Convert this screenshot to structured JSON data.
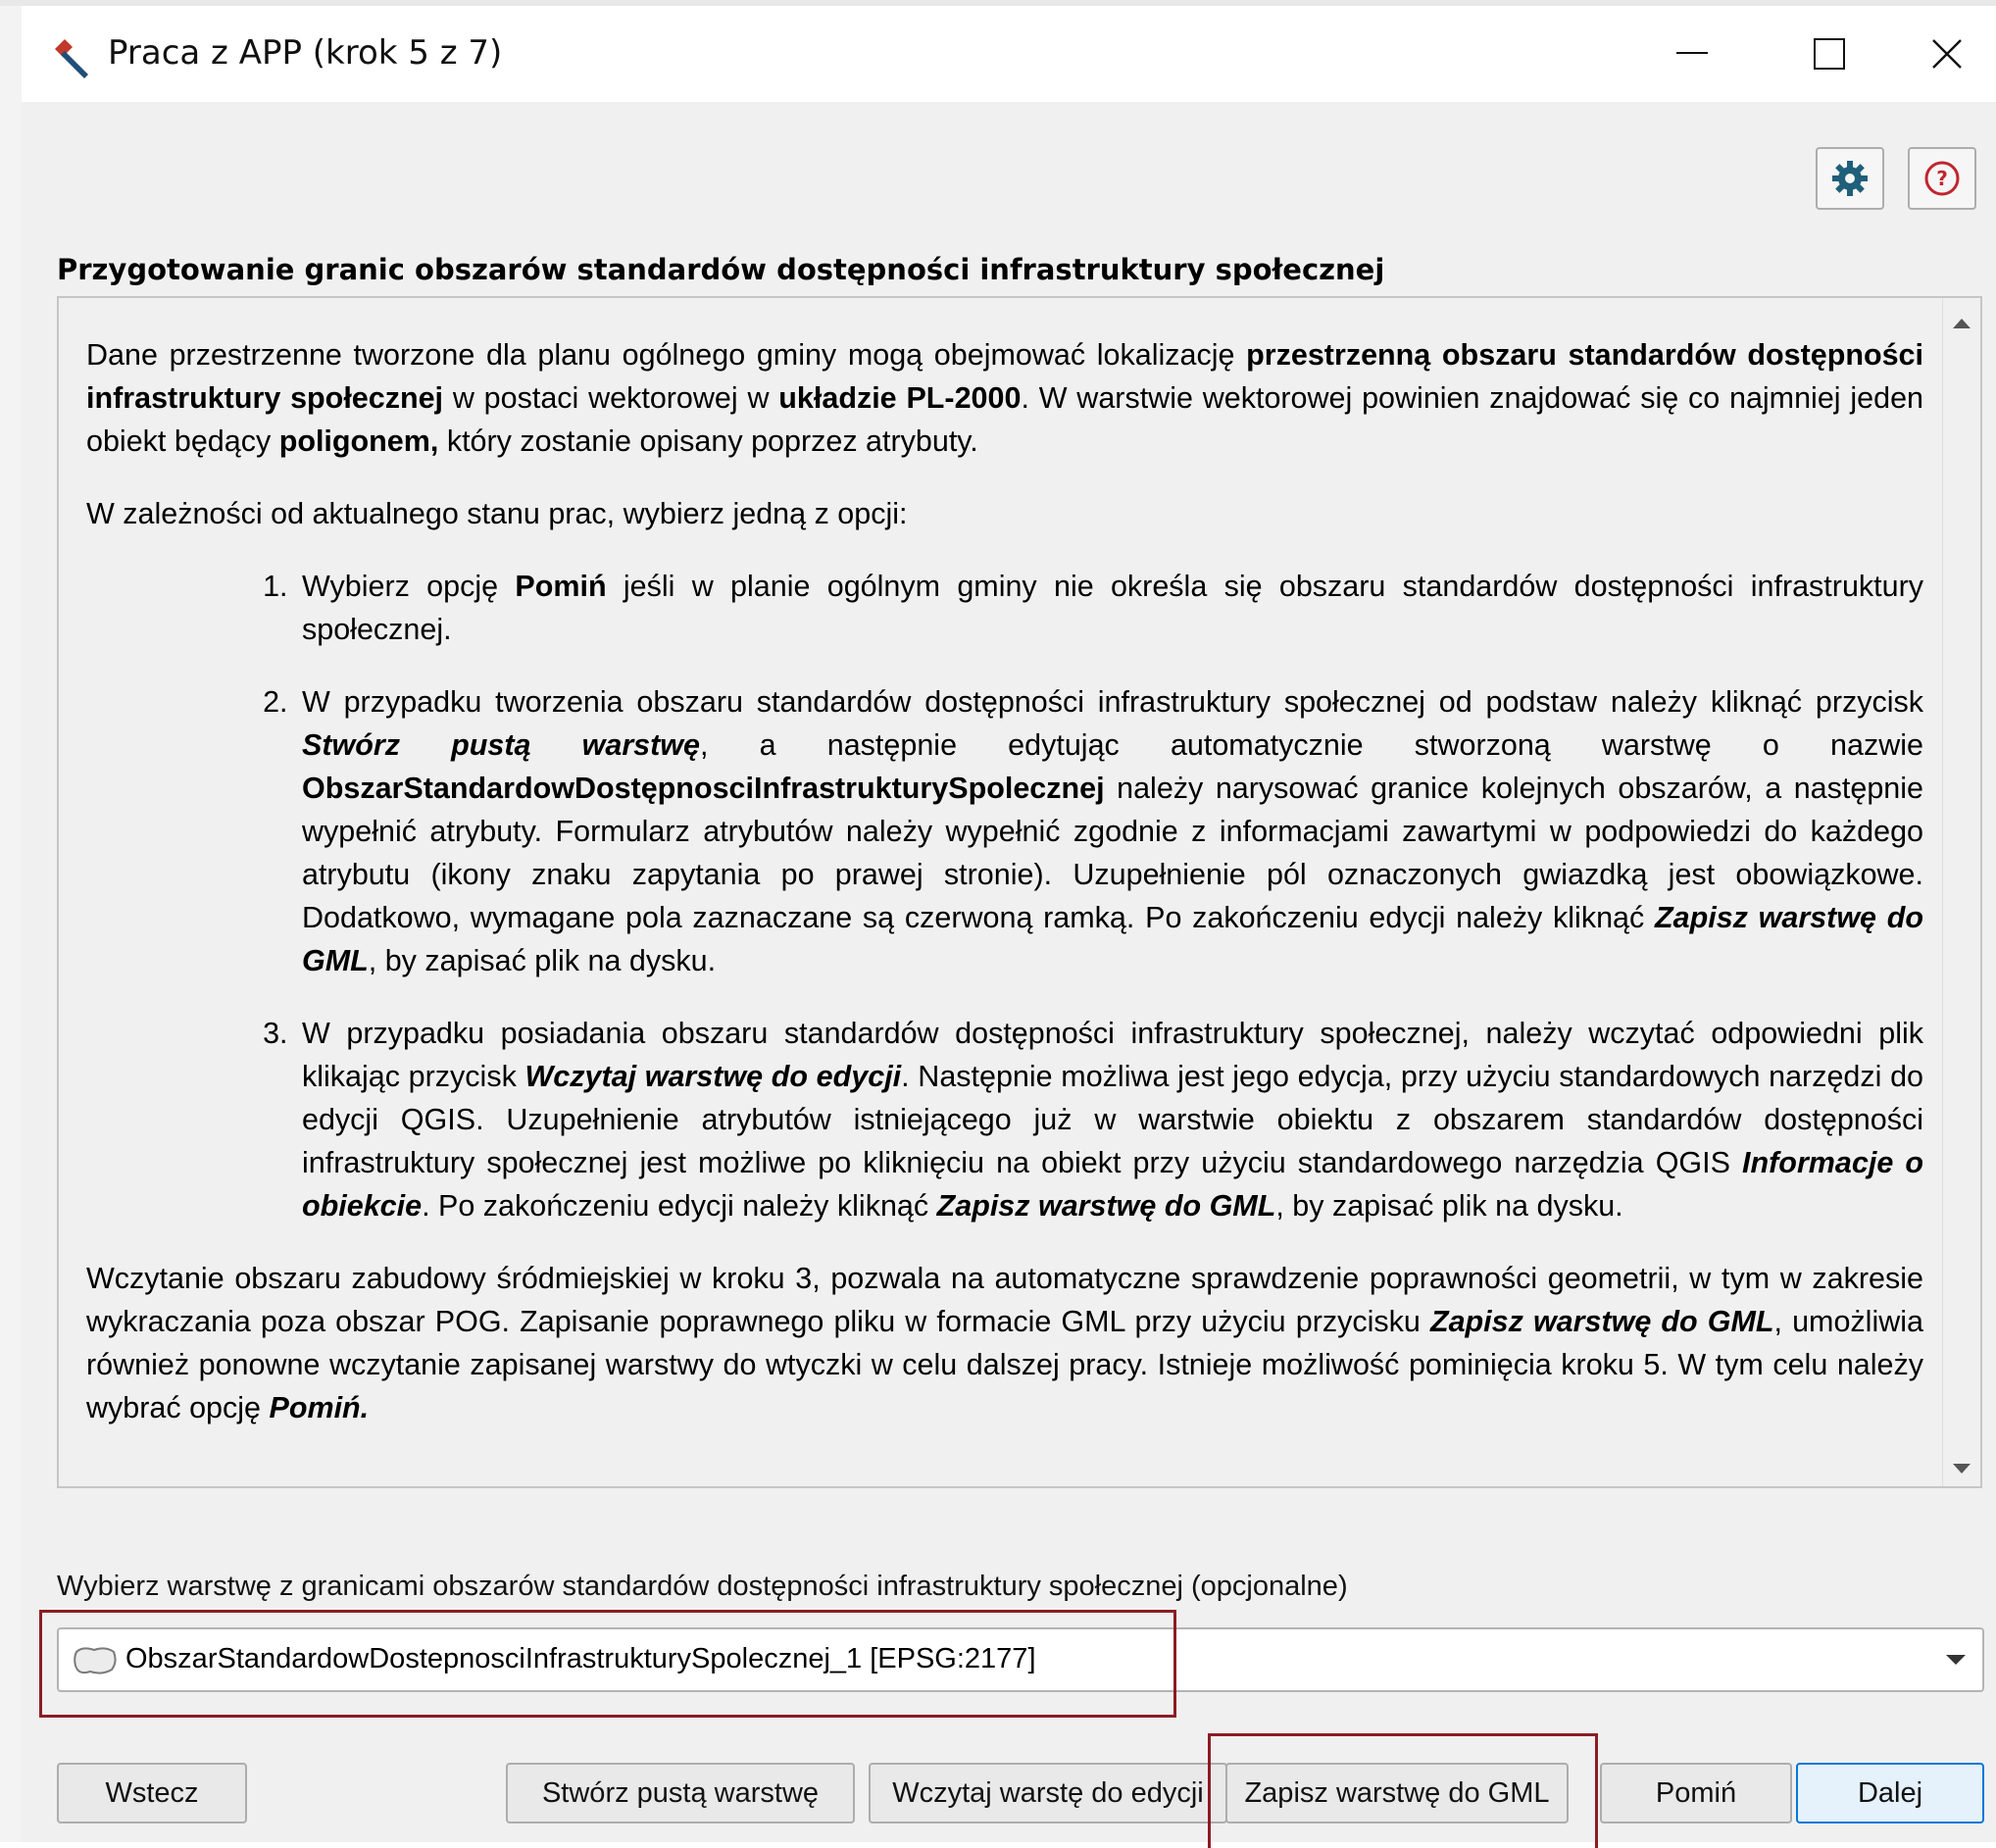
{
  "window": {
    "title": "Praca z APP (krok 5 z 7)"
  },
  "toolbar": {
    "settings_icon": "gear-icon",
    "help_icon": "question-icon"
  },
  "section": {
    "heading": "Przygotowanie granic obszarów standardów dostępności infrastruktury społecznej"
  },
  "description": {
    "p1": {
      "a": "Dane przestrzenne tworzone dla planu ogólnego gminy mogą obejmować lokalizację ",
      "b": "przestrzenną obszaru standardów dostępności infrastruktury społecznej",
      "c": " w postaci wektorowej w ",
      "d": "układzie PL-2000",
      "e": ". W warstwie wektorowej powinien znajdować się co najmniej jeden obiekt będący ",
      "f": "poligonem,",
      "g": " który zostanie opisany poprzez atrybuty."
    },
    "p2": "W zależności od aktualnego stanu prac, wybierz jedną z opcji:",
    "item1": {
      "a": "Wybierz opcję ",
      "b": "Pomiń",
      "c": " jeśli w planie ogólnym gminy nie określa się obszaru standardów dostępności infrastruktury społecznej."
    },
    "item2": {
      "a": "W przypadku tworzenia obszaru standardów dostępności infrastruktury społecznej od podstaw należy kliknąć przycisk  ",
      "b": "Stwórz pustą warstwę",
      "c": ", a następnie edytując automatycznie stworzoną warstwę o nazwie ",
      "d": "ObszarStandardowDostępnosciInfrastrukturySpolecznej",
      "e": " należy narysować granice kolejnych obszarów, a następnie wypełnić atrybuty. Formularz atrybutów należy wypełnić zgodnie z informacjami zawartymi w podpowiedzi do każdego atrybutu (ikony znaku zapytania po prawej stronie).  Uzupełnienie pól oznaczonych gwiazdką jest obowiązkowe. Dodatkowo, wymagane pola zaznaczane są czerwoną ramką. Po zakończeniu edycji należy kliknąć ",
      "f": "Zapisz warstwę do GML",
      "g": ", by zapisać plik na dysku."
    },
    "item3": {
      "a": "W przypadku posiadania obszaru standardów dostępności infrastruktury społecznej, należy wczytać odpowiedni plik klikając przycisk ",
      "b": "Wczytaj warstwę do edycji",
      "c": ". Następnie możliwa jest jego edycja, przy użyciu standardowych narzędzi do edycji QGIS. Uzupełnienie atrybutów istniejącego już w warstwie obiektu z obszarem standardów dostępności infrastruktury społecznej jest możliwe po kliknięciu na obiekt przy użyciu standardowego narzędzia QGIS ",
      "d": "Informacje o obiekcie",
      "e": ". Po zakończeniu edycji należy kliknąć ",
      "f": "Zapisz warstwę do GML",
      "g": ", by zapisać plik na dysku."
    },
    "p3": {
      "a": "Wczytanie obszaru zabudowy śródmiejskiej w kroku 3, pozwala na automatyczne sprawdzenie poprawności geometrii, w tym w zakresie wykraczania poza obszar POG. Zapisanie poprawnego pliku w formacie GML przy użyciu przycisku ",
      "b": "Zapisz warstwę do GML",
      "c": ", umożliwia również ponowne wczytanie zapisanej warstwy do wtyczki w celu dalszej pracy. Istnieje możliwość pominięcia kroku 5. W tym celu należy wybrać opcję ",
      "d": "Pomiń."
    }
  },
  "layer_select": {
    "label": "Wybierz warstwę z granicami obszarów standardów dostępności infrastruktury społecznej (opcjonalne)",
    "selected": "ObszarStandardowDostepnosciInfrastrukturySpolecznej_1 [EPSG:2177]",
    "icon": "polygon-layer-icon"
  },
  "buttons": {
    "back": "Wstecz",
    "create_empty": "Stwórz pustą warstwę",
    "load_edit": "Wczytaj warstę do edycji",
    "save_gml": "Zapisz warstwę do GML",
    "skip": "Pomiń",
    "next": "Dalej"
  },
  "colors": {
    "highlight_frame": "#8b1c24",
    "primary_border": "#0078d7",
    "settings_icon": "#1f5f7a",
    "help_icon": "#c0262d",
    "title_icon": "#c0392b"
  }
}
